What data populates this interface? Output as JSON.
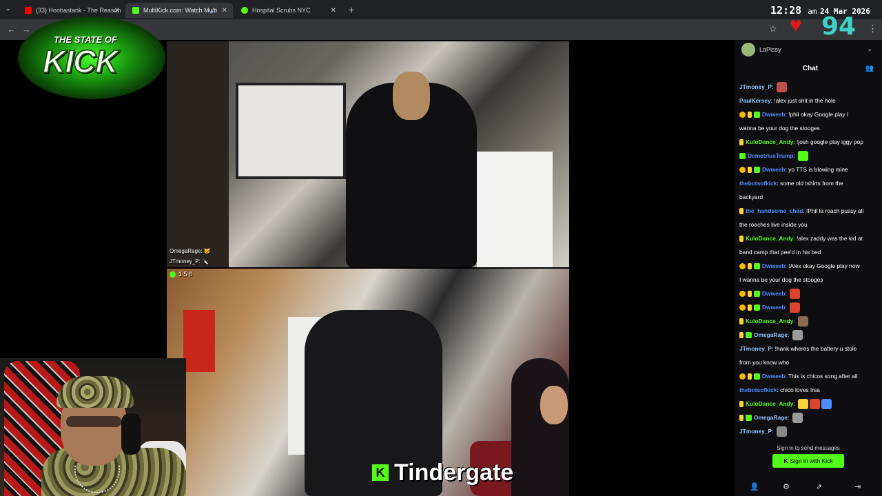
{
  "browser": {
    "tabs": [
      {
        "label": "(33) Hoobastank - The Reason",
        "favicon_color": "#ff0000"
      },
      {
        "label": "MultiKick.com: Watch Multi",
        "favicon_color": "#53fc18",
        "favicon_text": "MK"
      },
      {
        "label": "Hospital Scrubs NYC",
        "favicon_color": "#53fc18"
      }
    ],
    "new_tab": "+",
    "tab_close": "✕",
    "speaker": "🔈",
    "tab_menu": "⌄",
    "nav_back": "←",
    "nav_forward": "→",
    "star": "☆",
    "menu": "⋮"
  },
  "overlay": {
    "time": "12:28",
    "ampm": "am",
    "date": "24 Mar 2026",
    "heart": "♥",
    "number": "94",
    "logo_line1": "THE STATE OF",
    "logo_line2": "KICK"
  },
  "stream_top": {
    "chat_line1": "OmegaRage: 🐱",
    "chat_line2": "JTmoney_P: 🔪"
  },
  "stream_bottom": {
    "viewer_count": "1 5 6"
  },
  "caption": {
    "k_icon": "K",
    "text": "Tindergate"
  },
  "chat": {
    "channel": "LaPissy",
    "title": "Chat",
    "users_icon": "👥",
    "chevron": "⌄",
    "messages": [
      {
        "badges": [],
        "user": "JTmoney_P",
        "color": "#8ec5ff",
        "text": "",
        "emote_colors": [
          "#c0504a"
        ]
      },
      {
        "badges": [],
        "user": "PaulKersey",
        "color": "#8ec5ff",
        "text": "!alex just shit in the hole",
        "emote_colors": []
      },
      {
        "badges": [
          "b1",
          "b2",
          "b3"
        ],
        "user": "Dwweeb",
        "color": "#4f8cff",
        "text": "!phil okay Google play I",
        "emote_colors": []
      },
      {
        "cont": true,
        "text": "wanna be your dog the stooges"
      },
      {
        "badges": [
          "b2"
        ],
        "user": "KuloDance_Andy",
        "color": "#53fc18",
        "text": "!josh google play iggy pop",
        "emote_colors": []
      },
      {
        "badges": [
          "b3"
        ],
        "user": "DemetriusTrump",
        "color": "#4f8cff",
        "text": "",
        "emote_colors": [
          "#53fc18"
        ]
      },
      {
        "badges": [
          "b1",
          "b2",
          "b3"
        ],
        "user": "Dwweeb",
        "color": "#4f8cff",
        "text": "yo TTS is blowing mine",
        "emote_colors": []
      },
      {
        "badges": [],
        "user": "thebotsofkick",
        "color": "#4f8cff",
        "text": "some old tshirts from the",
        "emote_colors": []
      },
      {
        "cont": true,
        "text": "backyard"
      },
      {
        "badges": [
          "b2"
        ],
        "user": "the_handsome_chad",
        "color": "#4f8cff",
        "text": "!Phil la roach pussy all",
        "emote_colors": []
      },
      {
        "cont": true,
        "text": "the roaches live inside you"
      },
      {
        "badges": [
          "b2"
        ],
        "user": "KuloDance_Andy",
        "color": "#53fc18",
        "text": "!alex zaddy was the kid at",
        "emote_colors": []
      },
      {
        "cont": true,
        "text": "band camp that pee'd in his bed"
      },
      {
        "badges": [
          "b1",
          "b2",
          "b3"
        ],
        "user": "Dwweeb",
        "color": "#4f8cff",
        "text": "!Alex okay Google play now",
        "emote_colors": []
      },
      {
        "cont": true,
        "text": "I wanna be your dog the stooges"
      },
      {
        "badges": [
          "b1",
          "b2",
          "b3"
        ],
        "user": "Dwweeb",
        "color": "#4f8cff",
        "text": "",
        "emote_colors": [
          "#d8442e"
        ]
      },
      {
        "badges": [
          "b1",
          "b2",
          "b3"
        ],
        "user": "Dwweeb",
        "color": "#4f8cff",
        "text": "",
        "emote_colors": [
          "#d8442e"
        ]
      },
      {
        "badges": [
          "b2"
        ],
        "user": "KuloDance_Andy",
        "color": "#53fc18",
        "text": "",
        "emote_colors": [
          "#8a6a50"
        ]
      },
      {
        "badges": [
          "b2",
          "b3"
        ],
        "user": "OmegaRage",
        "color": "#8ec5ff",
        "text": "",
        "emote_colors": [
          "#9a9a9a"
        ]
      },
      {
        "badges": [],
        "user": "JTmoney_P",
        "color": "#8ec5ff",
        "text": "!hank wheres the battery u stole",
        "emote_colors": []
      },
      {
        "cont": true,
        "text": "from you know who"
      },
      {
        "badges": [
          "b1",
          "b2",
          "b3"
        ],
        "user": "Dwweeb",
        "color": "#4f8cff",
        "text": "This is chicos song after all",
        "emote_colors": []
      },
      {
        "badges": [],
        "user": "thebotsofkick",
        "color": "#4f8cff",
        "text": "chico loves Irsa",
        "emote_colors": []
      },
      {
        "badges": [
          "b2"
        ],
        "user": "KuloDance_Andy",
        "color": "#53fc18",
        "text": "",
        "emote_colors": [
          "#ffd23a",
          "#d8442e",
          "#4f8cff"
        ]
      },
      {
        "badges": [
          "b2",
          "b3"
        ],
        "user": "OmegaRage",
        "color": "#8ec5ff",
        "text": "",
        "emote_colors": [
          "#9a9a9a"
        ]
      },
      {
        "badges": [],
        "user": "JTmoney_P",
        "color": "#8ec5ff",
        "text": "",
        "emote_colors": [
          "#888888"
        ]
      }
    ],
    "signin_prompt": "Sign in to send messages",
    "signin_button": "Sign in with Kick",
    "signin_k": "K",
    "footer_icons": [
      "👤",
      "⚙",
      "⇗",
      "⇥"
    ]
  }
}
